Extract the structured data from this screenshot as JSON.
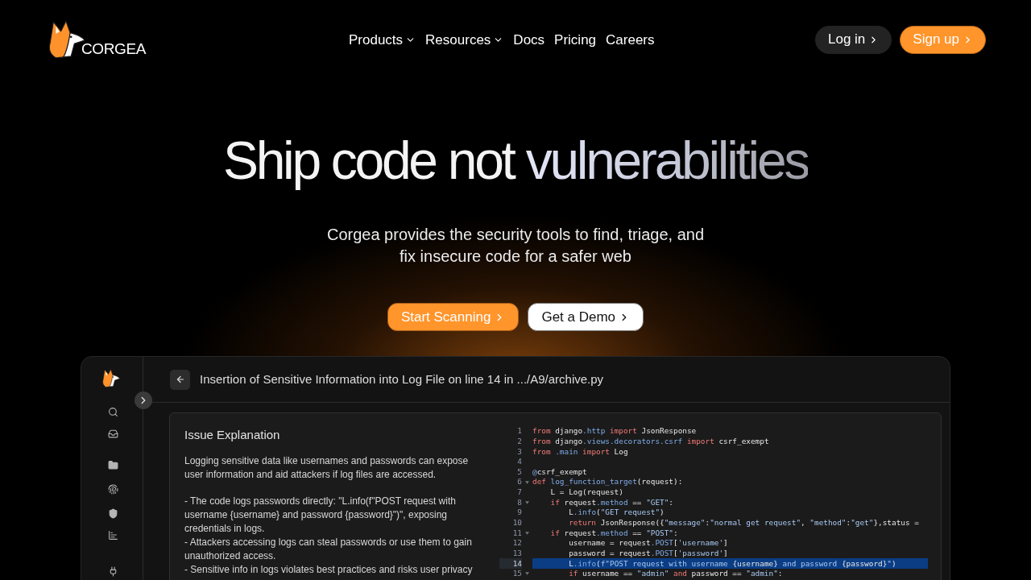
{
  "nav": {
    "logo": {
      "wordmark": "CORGEA"
    },
    "items": [
      {
        "label": "Products",
        "kind": "menu"
      },
      {
        "label": "Resources",
        "kind": "menu"
      },
      {
        "label": "Docs",
        "kind": "link"
      },
      {
        "label": "Pricing",
        "kind": "link"
      },
      {
        "label": "Careers",
        "kind": "link"
      }
    ],
    "actions": [
      {
        "label": "Log in",
        "kind": "secondary"
      },
      {
        "label": "Sign up",
        "kind": "primary"
      }
    ]
  },
  "hero": {
    "title": {
      "lead": "Ship code not",
      "highlight": "vulnerabilities"
    },
    "subtitle": "Corgea provides the security tools to find, triage, and fix insecure code for a safer web",
    "buttons": [
      {
        "label": "Start Scanning",
        "kind": "primary"
      },
      {
        "label": "Get a Demo",
        "kind": "secondary"
      }
    ]
  },
  "app_preview": {
    "header": {
      "title": "Insertion of Sensitive Information into Log File on line 14 in .../A9/archive.py"
    },
    "explanation": {
      "heading": "Issue Explanation",
      "intro": "Logging sensitive data like usernames and passwords can expose user information and aid attackers if log files are accessed.",
      "points": [
        "- The code logs passwords directly: \"L.info(f\"POST request with username {username} and password {password}\")\", exposing credentials in logs.",
        "- Attackers accessing logs can steal passwords or use them to gain unauthorized access.",
        "- Sensitive info in logs violates best practices and risks user privacy"
      ]
    },
    "code": {
      "lines": [
        {
          "number": "1",
          "selected": false,
          "fold": false,
          "tokens": [
            {
              "kind": "keyword",
              "text": "from"
            },
            {
              "kind": "text",
              "text": " django"
            },
            {
              "kind": "name",
              "text": ".http"
            },
            {
              "kind": "keyword",
              "text": " import"
            },
            {
              "kind": "text",
              "text": " JsonResponse"
            }
          ]
        },
        {
          "number": "2",
          "selected": false,
          "fold": false,
          "tokens": [
            {
              "kind": "keyword",
              "text": "from"
            },
            {
              "kind": "text",
              "text": " django"
            },
            {
              "kind": "name",
              "text": ".views.decorators.csrf"
            },
            {
              "kind": "keyword",
              "text": " import"
            },
            {
              "kind": "text",
              "text": " csrf_exempt"
            }
          ]
        },
        {
          "number": "3",
          "selected": false,
          "fold": false,
          "tokens": [
            {
              "kind": "keyword",
              "text": "from"
            },
            {
              "kind": "name",
              "text": " .main"
            },
            {
              "kind": "keyword",
              "text": " import"
            },
            {
              "kind": "text",
              "text": " Log"
            }
          ]
        },
        {
          "number": "4",
          "selected": false,
          "fold": false
        },
        {
          "number": "5",
          "selected": false,
          "fold": false,
          "tokens": [
            {
              "kind": "name",
              "text": "@"
            },
            {
              "kind": "text",
              "text": "csrf_exempt"
            }
          ]
        },
        {
          "number": "6",
          "selected": false,
          "fold": true,
          "tokens": [
            {
              "kind": "keyword",
              "text": "def"
            },
            {
              "kind": "name",
              "text": " log_function_target"
            },
            {
              "kind": "text",
              "text": "(request):"
            }
          ]
        },
        {
          "number": "7",
          "selected": false,
          "fold": false,
          "tokens": [
            {
              "kind": "text",
              "text": "    L = Log(request)"
            }
          ]
        },
        {
          "number": "8",
          "selected": false,
          "fold": true,
          "tokens": [
            {
              "kind": "keyword",
              "text": "    if"
            },
            {
              "kind": "text",
              "text": " request"
            },
            {
              "kind": "name",
              "text": ".method"
            },
            {
              "kind": "text",
              "text": " == "
            },
            {
              "kind": "string",
              "text": "\"GET\""
            },
            {
              "kind": "text",
              "text": ":"
            }
          ]
        },
        {
          "number": "9",
          "selected": false,
          "fold": false,
          "tokens": [
            {
              "kind": "text",
              "text": "        L"
            },
            {
              "kind": "name",
              "text": ".info"
            },
            {
              "kind": "text",
              "text": "("
            },
            {
              "kind": "string",
              "text": "\"GET request\""
            },
            {
              "kind": "text",
              "text": ")"
            }
          ]
        },
        {
          "number": "10",
          "selected": false,
          "fold": false,
          "tokens": [
            {
              "kind": "keyword",
              "text": "        return"
            },
            {
              "kind": "text",
              "text": " JsonResponse({"
            },
            {
              "kind": "string",
              "text": "\"message\""
            },
            {
              "kind": "text",
              "text": ":"
            },
            {
              "kind": "string",
              "text": "\"normal get request\""
            },
            {
              "kind": "text",
              "text": ", "
            },
            {
              "kind": "string",
              "text": "\"method\""
            },
            {
              "kind": "text",
              "text": ":"
            },
            {
              "kind": "string",
              "text": "\"get\""
            },
            {
              "kind": "text",
              "text": "},status ="
            }
          ]
        },
        {
          "number": "11",
          "selected": false,
          "fold": true,
          "tokens": [
            {
              "kind": "keyword",
              "text": "    if"
            },
            {
              "kind": "text",
              "text": " request"
            },
            {
              "kind": "name",
              "text": ".method"
            },
            {
              "kind": "text",
              "text": " == "
            },
            {
              "kind": "string",
              "text": "\"POST\""
            },
            {
              "kind": "text",
              "text": ":"
            }
          ]
        },
        {
          "number": "12",
          "selected": false,
          "fold": false,
          "tokens": [
            {
              "kind": "text",
              "text": "        username = request"
            },
            {
              "kind": "name",
              "text": ".POST"
            },
            {
              "kind": "text",
              "text": "["
            },
            {
              "kind": "string",
              "text": "'username'"
            },
            {
              "kind": "text",
              "text": "]"
            }
          ]
        },
        {
          "number": "13",
          "selected": false,
          "fold": false,
          "tokens": [
            {
              "kind": "text",
              "text": "        password = request"
            },
            {
              "kind": "name",
              "text": ".POST"
            },
            {
              "kind": "text",
              "text": "["
            },
            {
              "kind": "string",
              "text": "'password'"
            },
            {
              "kind": "text",
              "text": "]"
            }
          ]
        },
        {
          "number": "14",
          "selected": true,
          "fold": false,
          "tokens": [
            {
              "kind": "text",
              "text": "        L"
            },
            {
              "kind": "name",
              "text": ".info"
            },
            {
              "kind": "text",
              "text": "("
            },
            {
              "kind": "string",
              "text": "f\"POST request with username "
            },
            {
              "kind": "text",
              "text": "{username}"
            },
            {
              "kind": "string",
              "text": " and password "
            },
            {
              "kind": "text",
              "text": "{password}"
            },
            {
              "kind": "string",
              "text": "\""
            },
            {
              "kind": "text",
              "text": ")"
            }
          ]
        },
        {
          "number": "15",
          "selected": false,
          "fold": true,
          "tokens": [
            {
              "kind": "keyword",
              "text": "        if"
            },
            {
              "kind": "text",
              "text": " username == "
            },
            {
              "kind": "string",
              "text": "\"admin\""
            },
            {
              "kind": "keyword",
              "text": " and"
            },
            {
              "kind": "text",
              "text": " password == "
            },
            {
              "kind": "string",
              "text": "\"admin\""
            },
            {
              "kind": "text",
              "text": ":"
            }
          ]
        }
      ]
    }
  }
}
